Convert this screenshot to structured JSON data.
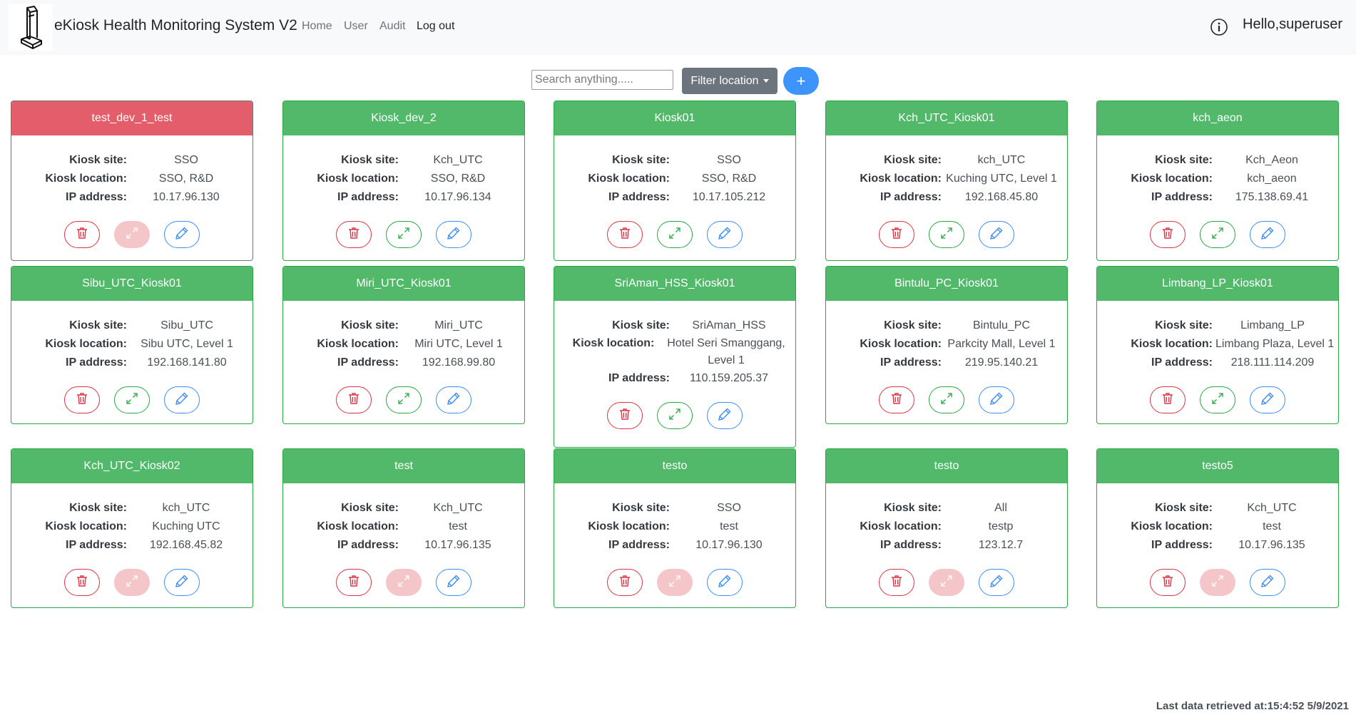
{
  "header": {
    "brand": "eKiosk Health Monitoring System V2",
    "nav": [
      "Home",
      "User",
      "Audit",
      "Log out"
    ],
    "greeting": "Hello,superuser"
  },
  "toolbar": {
    "search_placeholder": "Search anything.....",
    "filter_label": "Filter location",
    "add_label": "+"
  },
  "labels": {
    "site": "Kiosk site:",
    "location": "Kiosk location:",
    "ip": "IP address:"
  },
  "kiosks": [
    {
      "name": "test_dev_1_test",
      "site": "SSO",
      "location": "SSO, R&D",
      "ip": "10.17.96.130",
      "status": "offline"
    },
    {
      "name": "Kiosk_dev_2",
      "site": "Kch_UTC",
      "location": "SSO, R&D",
      "ip": "10.17.96.134",
      "status": "online"
    },
    {
      "name": "Kiosk01",
      "site": "SSO",
      "location": "SSO, R&D",
      "ip": "10.17.105.212",
      "status": "online"
    },
    {
      "name": "Kch_UTC_Kiosk01",
      "site": "kch_UTC",
      "location": "Kuching UTC, Level 1",
      "ip": "192.168.45.80",
      "status": "online"
    },
    {
      "name": "kch_aeon",
      "site": "Kch_Aeon",
      "location": "kch_aeon",
      "ip": "175.138.69.41",
      "status": "online"
    },
    {
      "name": "Sibu_UTC_Kiosk01",
      "site": "Sibu_UTC",
      "location": "Sibu UTC, Level 1",
      "ip": "192.168.141.80",
      "status": "online"
    },
    {
      "name": "Miri_UTC_Kiosk01",
      "site": "Miri_UTC",
      "location": "Miri UTC, Level 1",
      "ip": "192.168.99.80",
      "status": "online"
    },
    {
      "name": "SriAman_HSS_Kiosk01",
      "site": "SriAman_HSS",
      "location": "Hotel Seri Smanggang, Level 1",
      "ip": "110.159.205.37",
      "status": "online"
    },
    {
      "name": "Bintulu_PC_Kiosk01",
      "site": "Bintulu_PC",
      "location": "Parkcity Mall, Level 1",
      "ip": "219.95.140.21",
      "status": "online"
    },
    {
      "name": "Limbang_LP_Kiosk01",
      "site": "Limbang_LP",
      "location": "Limbang Plaza, Level 1",
      "ip": "218.111.114.209",
      "status": "online"
    },
    {
      "name": "Kch_UTC_Kiosk02",
      "site": "kch_UTC",
      "location": "Kuching UTC",
      "ip": "192.168.45.82",
      "status": "disabled"
    },
    {
      "name": "test",
      "site": "Kch_UTC",
      "location": "test",
      "ip": "10.17.96.135",
      "status": "disabled"
    },
    {
      "name": "testo",
      "site": "SSO",
      "location": "test",
      "ip": "10.17.96.130",
      "status": "disabled"
    },
    {
      "name": "testo",
      "site": "All",
      "location": "testp",
      "ip": "123.12.7",
      "status": "disabled"
    },
    {
      "name": "testo5",
      "site": "Kch_UTC",
      "location": "test",
      "ip": "10.17.96.135",
      "status": "disabled"
    }
  ],
  "footer": {
    "last_retrieved": "Last data retrieved at:15:4:52 5/9/2021"
  },
  "colors": {
    "online_header": "#52b96a",
    "offline_header": "#e35d6a",
    "delete": "#dc3545",
    "expand": "#28a745",
    "edit": "#3d8ef7"
  }
}
